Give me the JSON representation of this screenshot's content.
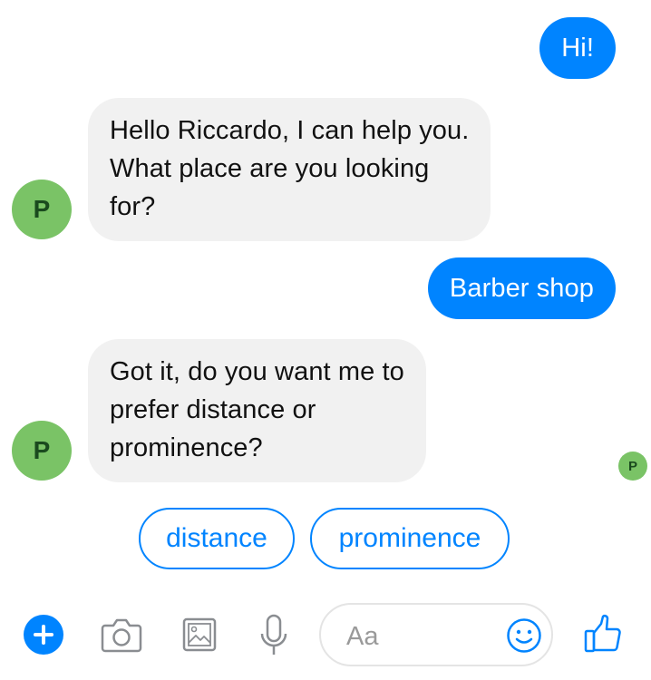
{
  "messages": [
    {
      "from": "user",
      "text": "Hi!"
    },
    {
      "from": "bot",
      "lines": [
        "Hello Riccardo, I can help you.",
        "What place are you looking",
        "for?"
      ]
    },
    {
      "from": "user",
      "text": "Barber shop"
    },
    {
      "from": "bot",
      "lines": [
        "Got it, do you want me to",
        "prefer distance or",
        "prominence?"
      ]
    }
  ],
  "bot": {
    "avatar_letter": "P",
    "avatar_color": "#7ac366"
  },
  "quick_replies": [
    "distance",
    "prominence"
  ],
  "composer": {
    "placeholder": "Aa"
  },
  "colors": {
    "accent": "#0084ff",
    "incoming_bubble": "#f1f1f1"
  },
  "icons": [
    "plus-icon",
    "camera-icon",
    "image-icon",
    "microphone-icon",
    "emoji-icon",
    "thumbs-up-icon"
  ]
}
